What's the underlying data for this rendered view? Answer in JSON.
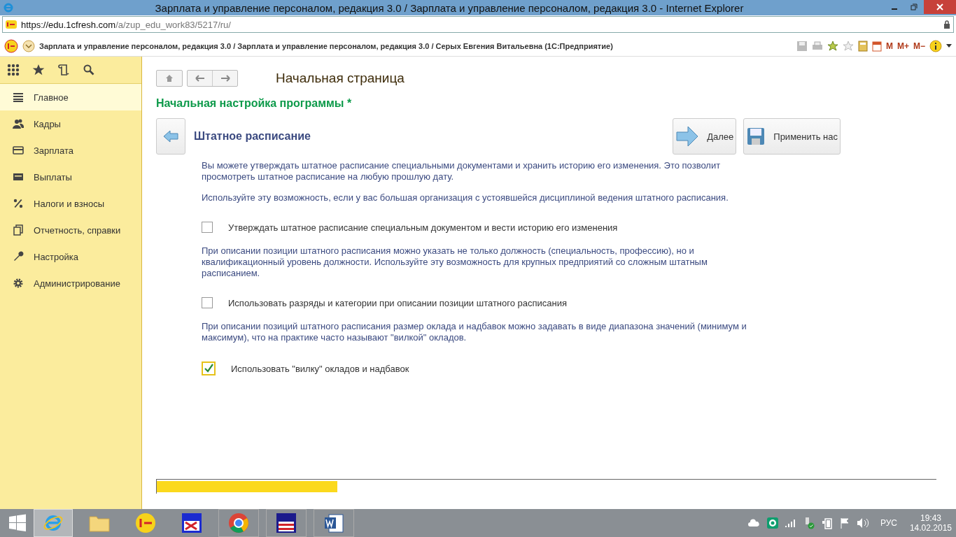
{
  "browser": {
    "title": "Зарплата и управление персоналом, редакция 3.0 / Зарплата и управление персоналом, редакция 3.0 - Internet Explorer",
    "url_host": "https://edu.1cfresh.com",
    "url_path": "/a/zup_edu_work83/5217/ru/"
  },
  "app_bar": {
    "title": "Зарплата и управление персоналом, редакция 3.0 / Зарплата и управление персоналом, редакция 3.0 / Серых Евгения Витальевна  (1С:Предприятие)",
    "memory_buttons": [
      "M",
      "M+",
      "M−"
    ]
  },
  "sidebar": {
    "items": [
      {
        "label": "Главное",
        "selected": true
      },
      {
        "label": "Кадры",
        "selected": false
      },
      {
        "label": "Зарплата",
        "selected": false
      },
      {
        "label": "Выплаты",
        "selected": false
      },
      {
        "label": "Налоги и взносы",
        "selected": false
      },
      {
        "label": "Отчетность, справки",
        "selected": false
      },
      {
        "label": "Настройка",
        "selected": false
      },
      {
        "label": "Администрирование",
        "selected": false
      }
    ]
  },
  "page": {
    "title": "Начальная страница",
    "section": "Начальная настройка программы *",
    "step_title": "Штатное расписание",
    "buttons": [
      "Далее",
      "Применить нас"
    ],
    "blocks": [
      {
        "paragraphs": [
          "Вы можете утверждать штатное расписание специальными документами и хранить историю его изменения. Это позволит просмотреть штатное расписание на любую прошлую дату.",
          "Используйте эту возможность, если у вас большая организация с устоявшейся дисциплиной ведения штатного расписания."
        ],
        "option": {
          "label": "Утверждать штатное расписание специальным документом и вести историю его изменения",
          "checked": false
        }
      },
      {
        "paragraphs": [
          "При описании позиции штатного расписания можно указать не только должность (специальность, профессию), но и квалификационный уровень должности. Используйте эту возможность для крупных предприятий со сложным штатным расписанием."
        ],
        "option": {
          "label": "Использовать разряды и категории при описании позиции штатного расписания",
          "checked": false
        }
      },
      {
        "paragraphs": [
          "При описании позиций штатного расписания размер оклада и надбавок можно задавать в виде диапазона значений (минимум и максимум), что на практике часто называют \"вилкой\" окладов."
        ],
        "option": {
          "label": "Использовать \"вилку\" окладов и надбавок",
          "checked": true
        }
      }
    ]
  },
  "taskbar": {
    "language": "РУС",
    "time": "19:43",
    "date": "14.02.2015"
  }
}
